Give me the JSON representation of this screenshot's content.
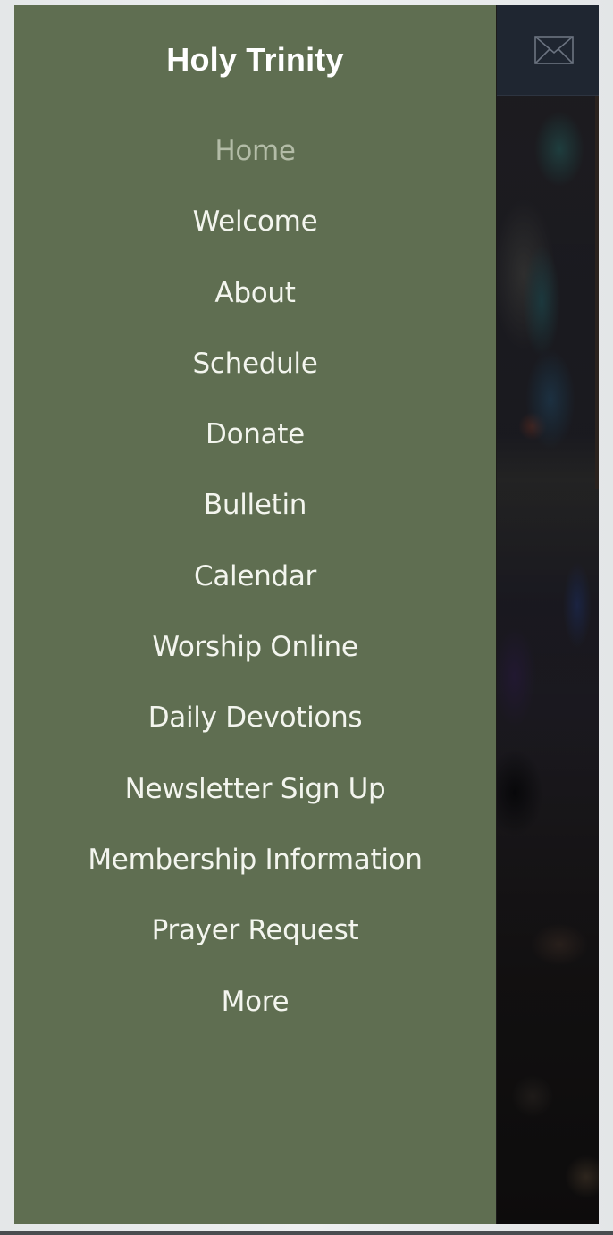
{
  "site": {
    "title": "Holy Trinity"
  },
  "header": {
    "mail_icon": "envelope-icon"
  },
  "menu": {
    "active_index": 0,
    "items": [
      {
        "label": "Home",
        "active": true
      },
      {
        "label": "Welcome",
        "active": false
      },
      {
        "label": "About",
        "active": false
      },
      {
        "label": "Schedule",
        "active": false
      },
      {
        "label": "Donate",
        "active": false
      },
      {
        "label": "Bulletin",
        "active": false
      },
      {
        "label": "Calendar",
        "active": false
      },
      {
        "label": "Worship Online",
        "active": false
      },
      {
        "label": "Daily Devotions",
        "active": false
      },
      {
        "label": "Newsletter Sign Up",
        "active": false
      },
      {
        "label": "Membership Information",
        "active": false
      },
      {
        "label": "Prayer Request",
        "active": false
      },
      {
        "label": "More",
        "active": false
      }
    ]
  },
  "colors": {
    "drawer_bg": "#5f6e51",
    "menu_text": "#f3f5ee",
    "menu_active_text": "#b3bca7",
    "header_bg": "#1f2631"
  }
}
